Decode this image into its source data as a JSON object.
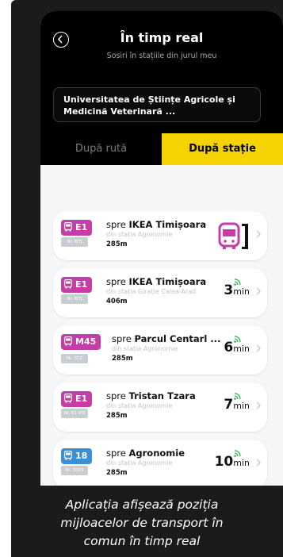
{
  "header": {
    "title": "În timp real",
    "subtitle": "Sosiri în stațiile din jurul meu",
    "station": "Universitatea de Științe Agricole și Medicină Veterinară ..."
  },
  "tabs": [
    {
      "label": "După rută",
      "active": false
    },
    {
      "label": "După stație",
      "active": true
    }
  ],
  "arrivals": [
    {
      "line": "E1",
      "vehicle": "Nr. MTJ",
      "prefix": "spre",
      "destination": "IKEA Timișoara",
      "from": "din stația Agronomie",
      "distance": "285m",
      "eta": "",
      "eta_unit": "",
      "arriving": true,
      "color": "#c43ea6"
    },
    {
      "line": "E1",
      "vehicle": "Nr. MTJ",
      "prefix": "spre",
      "destination": "IKEA Timișoara",
      "from": "din stația Girație Calea Arad",
      "distance": "406m",
      "eta": "3",
      "eta_unit": "min",
      "arriving": false,
      "color": "#c43ea6"
    },
    {
      "line": "M45",
      "vehicle": "Nr. TCZ",
      "prefix": "spre",
      "destination": "Parcul Centarl ...",
      "from": "din stația Agronomie",
      "distance": "285m",
      "eta": "6",
      "eta_unit": "min",
      "arriving": false,
      "color": "#c43ea6"
    },
    {
      "line": "E1",
      "vehicle": "Nr. 01 VYI",
      "prefix": "spre",
      "destination": "Tristan Tzara",
      "from": "din stația Agronomie",
      "distance": "285m",
      "eta": "7",
      "eta_unit": "min",
      "arriving": false,
      "color": "#c43ea6"
    },
    {
      "line": "18",
      "vehicle": "Nr. 3003",
      "prefix": "spre",
      "destination": "Agronomie",
      "from": "din stația Agronomie",
      "distance": "285m",
      "eta": "10",
      "eta_unit": "min",
      "arriving": false,
      "color": "#3a8fd6"
    }
  ],
  "caption": {
    "lines": [
      "Aplicația afișează poziția",
      "mijloacelor de transport în",
      "comun în timp real"
    ]
  },
  "colors": {
    "accent": "#f5d300",
    "realtime": "#27b34a",
    "arriving": "#c43ea6"
  }
}
